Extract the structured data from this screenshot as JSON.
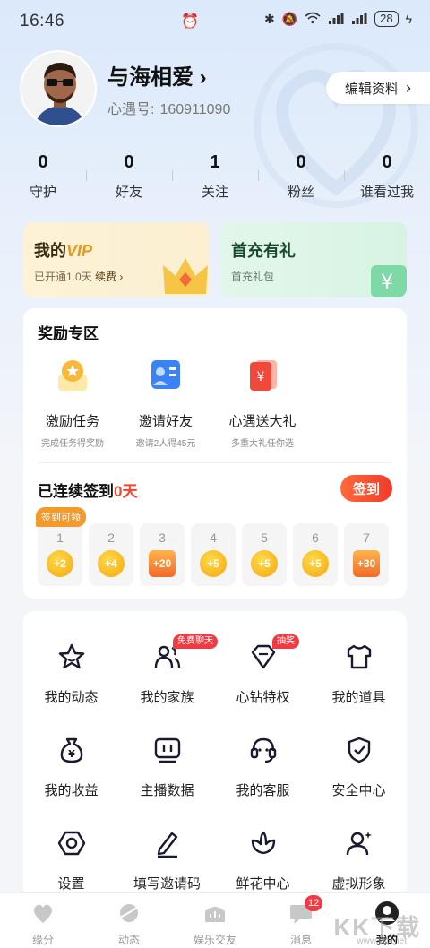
{
  "status_bar": {
    "time": "16:46",
    "battery": "28"
  },
  "profile": {
    "name": "与海相爱",
    "name_arrow": "›",
    "id_label": "心遇号:",
    "id_value": "160911090",
    "edit_label": "编辑资料",
    "edit_arrow": "›"
  },
  "stats": [
    {
      "value": "0",
      "label": "守护"
    },
    {
      "value": "0",
      "label": "好友"
    },
    {
      "value": "1",
      "label": "关注"
    },
    {
      "value": "0",
      "label": "粉丝"
    },
    {
      "value": "0",
      "label": "谁看过我"
    }
  ],
  "promo": {
    "vip": {
      "title_prefix": "我的",
      "title_vip": "VIP",
      "sub_prefix": "已开通1.0天",
      "sub_link": "续费",
      "sub_arrow": "›"
    },
    "charge": {
      "title": "首充有礼",
      "sub": "首充礼包"
    }
  },
  "rewards": {
    "title": "奖励专区",
    "items": [
      {
        "label": "激励任务",
        "sub": "完成任务得奖励",
        "icon": "task-icon"
      },
      {
        "label": "邀请好友",
        "sub": "邀请2人得45元",
        "icon": "invite-card-icon"
      },
      {
        "label": "心遇送大礼",
        "sub": "多重大礼任你选",
        "icon": "red-packet-icon"
      }
    ]
  },
  "checkin": {
    "title_prefix": "已连续签到",
    "days": "0天",
    "button": "签到",
    "claim_tag": "签到可领",
    "days_list": [
      {
        "day": "1",
        "reward": "+2",
        "type": "coin"
      },
      {
        "day": "2",
        "reward": "+4",
        "type": "coin"
      },
      {
        "day": "3",
        "reward": "+20",
        "type": "gift"
      },
      {
        "day": "4",
        "reward": "+5",
        "type": "coin"
      },
      {
        "day": "5",
        "reward": "+5",
        "type": "coin"
      },
      {
        "day": "6",
        "reward": "+5",
        "type": "coin"
      },
      {
        "day": "7",
        "reward": "+30",
        "type": "gift"
      }
    ]
  },
  "menu": [
    {
      "label": "我的动态",
      "icon": "star-icon"
    },
    {
      "label": "我的家族",
      "icon": "family-icon",
      "badge": "免费聊天"
    },
    {
      "label": "心钻特权",
      "icon": "diamond-icon",
      "badge": "抽奖"
    },
    {
      "label": "我的道具",
      "icon": "shirt-icon"
    },
    {
      "label": "我的收益",
      "icon": "money-bag-icon"
    },
    {
      "label": "主播数据",
      "icon": "tv-icon"
    },
    {
      "label": "我的客服",
      "icon": "headset-icon"
    },
    {
      "label": "安全中心",
      "icon": "shield-icon"
    },
    {
      "label": "设置",
      "icon": "settings-icon"
    },
    {
      "label": "填写邀请码",
      "icon": "pen-icon"
    },
    {
      "label": "鲜花中心",
      "icon": "flower-icon"
    },
    {
      "label": "虚拟形象",
      "icon": "avatar-sparkle-icon"
    }
  ],
  "bottom_nav": [
    {
      "label": "缘分",
      "icon": "heart-icon"
    },
    {
      "label": "动态",
      "icon": "planet-icon"
    },
    {
      "label": "娱乐交友",
      "icon": "crown-icon"
    },
    {
      "label": "消息",
      "icon": "chat-icon",
      "badge": "12"
    },
    {
      "label": "我的",
      "icon": "profile-icon",
      "active": true
    }
  ],
  "site_watermark": {
    "main": "KK下载",
    "sub": "www.kkx.net"
  },
  "colors": {
    "accent": "#f03b2b",
    "coin": "#f3a810",
    "vip_gold": "#e39a1b"
  }
}
